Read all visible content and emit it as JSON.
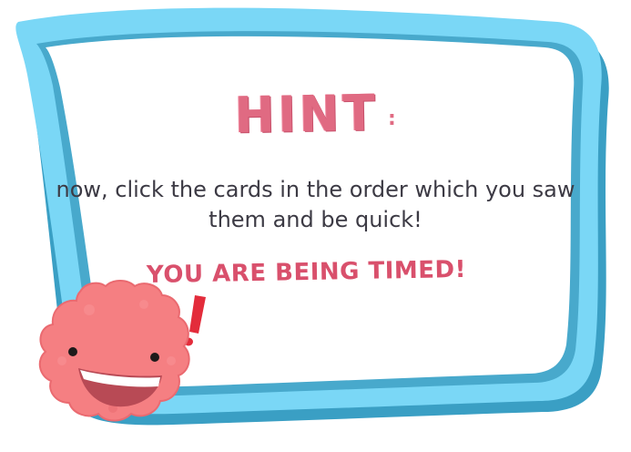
{
  "hint": {
    "title": "HINT",
    "colon": ":",
    "message": "now, click the cards in the order which you saw them and be quick!",
    "timed_warning": "YOU ARE BEING TIMED!"
  },
  "colors": {
    "frame_outer": "#3a9fc4",
    "frame_inner": "#7ad7f6",
    "panel": "#ffffff",
    "title": "#e06a82",
    "warning": "#d9506c",
    "body_text": "#3c3a44",
    "mascot_body": "#f57f82",
    "exclaim": "#e32c3b"
  },
  "icons": {
    "mascot": "pink-fuzzy-creature-icon",
    "exclaim": "exclamation-icon"
  }
}
